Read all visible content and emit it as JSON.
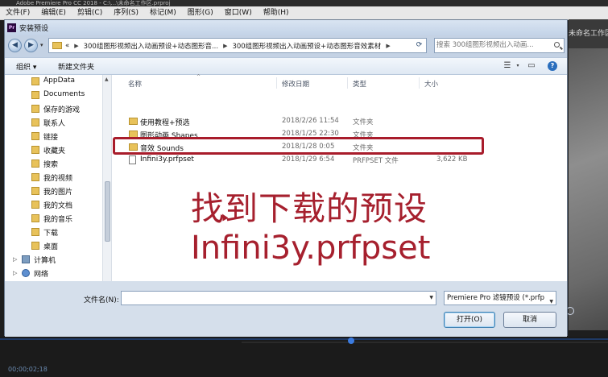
{
  "app": {
    "title": "Adobe Premiere Pro CC 2018 - C:\\...\\未命名工作区.prproj",
    "menu": [
      "文件(F)",
      "编辑(E)",
      "剪辑(C)",
      "序列(S)",
      "标记(M)",
      "图形(G)",
      "窗口(W)",
      "帮助(H)"
    ],
    "workspace_label": "未命名工作区",
    "timecode": "00;00;02;18"
  },
  "dialog": {
    "title": "安装预设",
    "breadcrumbs": [
      "«",
      "300组图形视频出入动画预设+动态图形音...",
      "300组图形视频出入动画预设+动态图形音效素材"
    ],
    "search_placeholder": "搜索 300组图形视频出入动画...",
    "toolbar": {
      "organize": "组织 ▾",
      "new_folder": "新建文件夹"
    },
    "sidebar": [
      {
        "label": "AppData",
        "icon": "folder-icon"
      },
      {
        "label": "Documents",
        "icon": "folder-icon"
      },
      {
        "label": "保存的游戏",
        "icon": "folder-icon"
      },
      {
        "label": "联系人",
        "icon": "folder-icon"
      },
      {
        "label": "链接",
        "icon": "folder-icon"
      },
      {
        "label": "收藏夹",
        "icon": "folder-icon"
      },
      {
        "label": "搜索",
        "icon": "folder-icon"
      },
      {
        "label": "我的视频",
        "icon": "folder-icon"
      },
      {
        "label": "我的图片",
        "icon": "folder-icon"
      },
      {
        "label": "我的文档",
        "icon": "folder-icon"
      },
      {
        "label": "我的音乐",
        "icon": "folder-icon"
      },
      {
        "label": "下载",
        "icon": "folder-icon"
      },
      {
        "label": "桌面",
        "icon": "folder-icon"
      },
      {
        "label": "计算机",
        "icon": "computer-icon"
      },
      {
        "label": "网络",
        "icon": "network-icon"
      }
    ],
    "columns": {
      "name": "名称",
      "date": "修改日期",
      "type": "类型",
      "size": "大小"
    },
    "files": [
      {
        "name": "使用教程+预选",
        "date": "2018/2/26 11:54",
        "type": "文件夹",
        "size": "",
        "kind": "folder"
      },
      {
        "name": "图形动画 Shapes",
        "date": "2018/1/25 22:30",
        "type": "文件夹",
        "size": "",
        "kind": "folder"
      },
      {
        "name": "音效 Sounds",
        "date": "2018/1/28 0:05",
        "type": "文件夹",
        "size": "",
        "kind": "folder"
      },
      {
        "name": "Infini3y.prfpset",
        "date": "2018/1/29 6:54",
        "type": "PRFPSET 文件",
        "size": "3,622 KB",
        "kind": "file"
      }
    ],
    "overlay": {
      "line1": "找到下载的预设",
      "line2": "Infini3y.prfpset",
      "color": "#a6202e"
    },
    "filename_label": "文件名(N):",
    "filename_value": "",
    "filetype": "Premiere Pro 滤镜预设 (*.prfp",
    "open_button": "打开(O)",
    "cancel_button": "取消"
  }
}
